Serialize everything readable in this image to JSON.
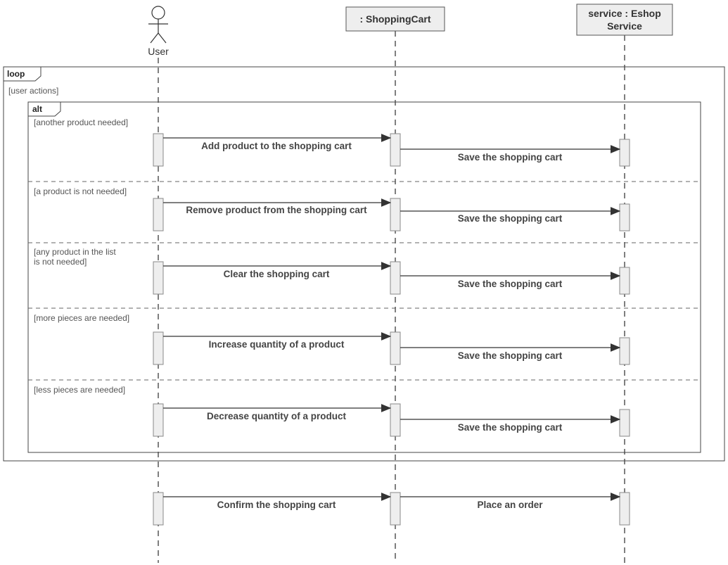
{
  "actors": {
    "user": "User",
    "cart_header": ": ShoppingCart",
    "service_header_line1": "service : Eshop",
    "service_header_line2": "Service"
  },
  "frames": {
    "loop_label": "loop",
    "loop_guard": "[user actions]",
    "alt_label": "alt"
  },
  "guards": {
    "another_product": "[another product needed]",
    "not_needed": "[a product is not needed]",
    "any_not_needed_line1": "[any product in the list",
    "any_not_needed_line2": "is not needed]",
    "more_pieces": "[more pieces are needed]",
    "less_pieces": "[less pieces are needed]"
  },
  "messages": {
    "add": "Add product to the shopping cart",
    "remove": "Remove product from the shopping cart",
    "clear": "Clear the shopping cart",
    "increase": "Increase quantity of a product",
    "decrease": "Decrease quantity of a product",
    "confirm": "Confirm the shopping cart",
    "save": "Save the shopping cart",
    "place_order": "Place an order"
  },
  "chart_data": {
    "type": "uml-sequence-diagram",
    "participants": [
      {
        "id": "user",
        "name": "User",
        "kind": "actor"
      },
      {
        "id": "cart",
        "name": ": ShoppingCart",
        "kind": "object"
      },
      {
        "id": "service",
        "name": "service : Eshop Service",
        "kind": "object"
      }
    ],
    "fragments": [
      {
        "type": "loop",
        "guard": "user actions",
        "contents": [
          {
            "type": "alt",
            "operands": [
              {
                "guard": "another product needed",
                "messages": [
                  {
                    "from": "user",
                    "to": "cart",
                    "label": "Add product to the shopping cart"
                  },
                  {
                    "from": "cart",
                    "to": "service",
                    "label": "Save the shopping cart"
                  }
                ]
              },
              {
                "guard": "a product is not needed",
                "messages": [
                  {
                    "from": "user",
                    "to": "cart",
                    "label": "Remove product from the shopping cart"
                  },
                  {
                    "from": "cart",
                    "to": "service",
                    "label": "Save the shopping cart"
                  }
                ]
              },
              {
                "guard": "any product in the list is not needed",
                "messages": [
                  {
                    "from": "user",
                    "to": "cart",
                    "label": "Clear the shopping cart"
                  },
                  {
                    "from": "cart",
                    "to": "service",
                    "label": "Save the shopping cart"
                  }
                ]
              },
              {
                "guard": "more pieces are needed",
                "messages": [
                  {
                    "from": "user",
                    "to": "cart",
                    "label": "Increase quantity of a product"
                  },
                  {
                    "from": "cart",
                    "to": "service",
                    "label": "Save the shopping cart"
                  }
                ]
              },
              {
                "guard": "less pieces are needed",
                "messages": [
                  {
                    "from": "user",
                    "to": "cart",
                    "label": "Decrease quantity of a product"
                  },
                  {
                    "from": "cart",
                    "to": "service",
                    "label": "Save the shopping cart"
                  }
                ]
              }
            ]
          }
        ]
      },
      {
        "type": "sequence",
        "messages": [
          {
            "from": "user",
            "to": "cart",
            "label": "Confirm the shopping cart"
          },
          {
            "from": "cart",
            "to": "service",
            "label": "Place an order"
          }
        ]
      }
    ]
  }
}
